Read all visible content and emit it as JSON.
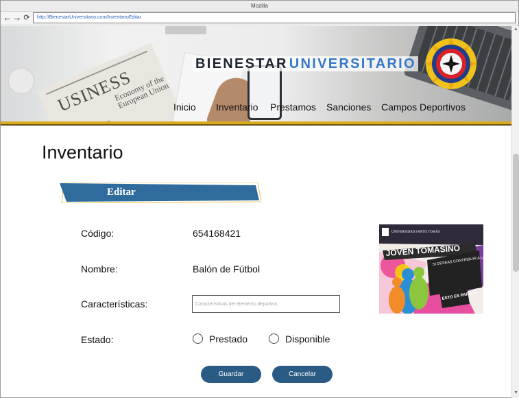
{
  "browser": {
    "window_title": "Mozilla",
    "url": "http://BienestarUniversitario.com/InventarioEditar"
  },
  "header": {
    "brand_part1": "BIENESTAR",
    "brand_part2": "UNIVERSITARIO",
    "background_text": "USINESS",
    "background_subtext": "Economy of the European Union",
    "menu": [
      "Inicio",
      "Inventario",
      "Prestamos",
      "Sanciones",
      "Campos Deportivos"
    ]
  },
  "page": {
    "title": "Inventario",
    "section_banner": "Editar"
  },
  "form": {
    "codigo_label": "Código:",
    "codigo_value": "654168421",
    "nombre_label": "Nombre:",
    "nombre_value": "Balón de Fútbol",
    "caracteristicas_label": "Características:",
    "caracteristicas_placeholder": "Características del elemento deportivo",
    "estado_label": "Estado:",
    "estado_options": [
      "Prestado",
      "Disponible"
    ],
    "save_label": "Guardar",
    "cancel_label": "Cancelar"
  },
  "ad": {
    "university": "UNIVERSIDAD SANTO TOMÁS",
    "headline": "JOVEN TOMASINO",
    "body": "SI DESEAS CONTRIBUIR A LA TRANSFORMACIÓN DE NUESTRA COMUNIDAD",
    "footer": "ESTO ES PARA TI"
  },
  "colors": {
    "gold": "#d8ac1e",
    "banner_blue": "#2f6c9d",
    "button_blue": "#2a5b85",
    "brand_blue": "#3578c8"
  },
  "icons": [
    "back-arrow-icon",
    "forward-arrow-icon",
    "reload-icon",
    "university-seal-icon"
  ]
}
